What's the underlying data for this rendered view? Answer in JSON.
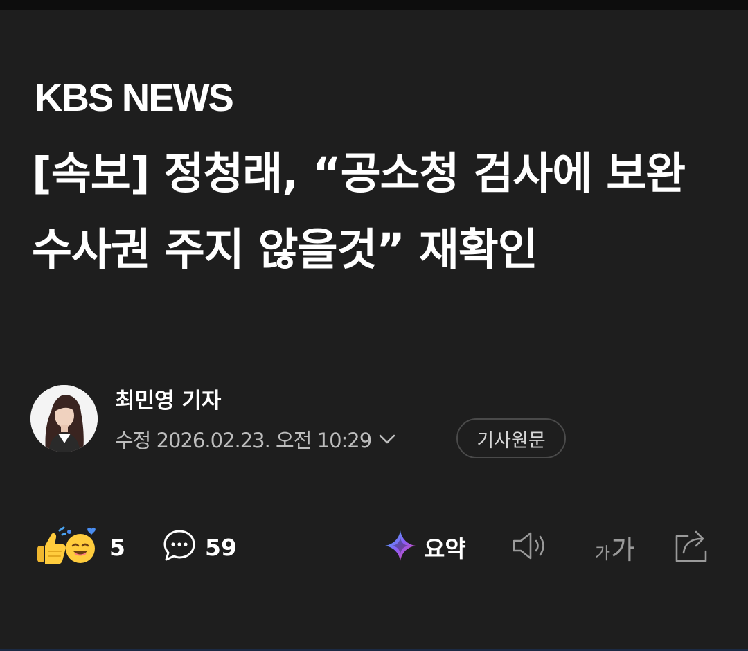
{
  "source": {
    "logo_text": "KBS NEWS"
  },
  "article": {
    "headline": "[속보] 정청래, “공소청 검사에 보완수사권 주지 않을것” 재확인"
  },
  "byline": {
    "reporter": "최민영 기자",
    "date_text": "수정 2026.02.23. 오전 10:29",
    "original_button": "기사원문"
  },
  "actions": {
    "reaction_count": "5",
    "comment_count": "59",
    "summary_label": "요약",
    "font_size_small": "가",
    "font_size_large": "가"
  },
  "icons": [
    "thumbs-up-icon",
    "smile-emoji-icon",
    "comment-bubble-icon",
    "ai-summary-icon",
    "speaker-icon",
    "font-size-icon",
    "share-icon",
    "chevron-down-icon"
  ],
  "colors": {
    "background": "#1e1e1e",
    "text_primary": "#ffffff",
    "text_secondary": "#bdbdbd",
    "icon_muted": "#9a9a9a",
    "summary_gradient": [
      "#3b82f6",
      "#a855f7",
      "#ec4899"
    ]
  }
}
